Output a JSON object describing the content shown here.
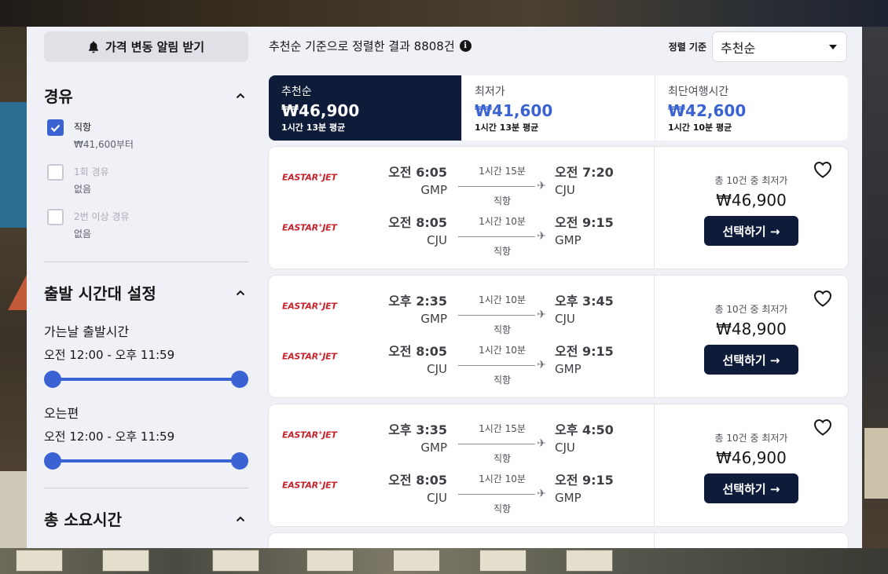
{
  "sidebar": {
    "alert_label": "가격 변동 알림 받기",
    "stops": {
      "title": "경유",
      "options": [
        {
          "label": "직항",
          "sub": "₩41,600부터"
        },
        {
          "label": "1회 경유",
          "sub": "없음"
        },
        {
          "label": "2번 이상 경유",
          "sub": "없음"
        }
      ]
    },
    "departure": {
      "title": "출발 시간대 설정",
      "outbound_label": "가는날 출발시간",
      "outbound_range": "오전 12:00 - 오후 11:59",
      "return_label": "오는편",
      "return_range": "오전 12:00 - 오후 11:59"
    },
    "duration": {
      "title": "총 소요시간"
    }
  },
  "summary": {
    "text": "추천순 기준으로 정렬한 결과 8808건",
    "info_icon": "i"
  },
  "sort": {
    "label": "정렬 기준",
    "value": "추천순"
  },
  "tabs": [
    {
      "name": "추천순",
      "price": "₩46,900",
      "duration": "1시간 13분 평균"
    },
    {
      "name": "최저가",
      "price": "₩41,600",
      "duration": "1시간 13분 평균"
    },
    {
      "name": "최단여행시간",
      "price": "₩42,600",
      "duration": "1시간 10분 평균"
    }
  ],
  "results": [
    {
      "legs": [
        {
          "airline": "EASTAR",
          "airline_b": "JET",
          "dep_time": "오전 6:05",
          "dep_code": "GMP",
          "duration": "1시간 15분",
          "type": "직항",
          "arr_time": "오전 7:20",
          "arr_code": "CJU"
        },
        {
          "airline": "EASTAR",
          "airline_b": "JET",
          "dep_time": "오전 8:05",
          "dep_code": "CJU",
          "duration": "1시간 10분",
          "type": "직항",
          "arr_time": "오전 9:15",
          "arr_code": "GMP"
        }
      ],
      "price_note": "총 10건 중 최저가",
      "price": "₩46,900",
      "button": "선택하기 →"
    },
    {
      "legs": [
        {
          "airline": "EASTAR",
          "airline_b": "JET",
          "dep_time": "오후 2:35",
          "dep_code": "GMP",
          "duration": "1시간 10분",
          "type": "직항",
          "arr_time": "오후 3:45",
          "arr_code": "CJU"
        },
        {
          "airline": "EASTAR",
          "airline_b": "JET",
          "dep_time": "오전 8:05",
          "dep_code": "CJU",
          "duration": "1시간 10분",
          "type": "직항",
          "arr_time": "오전 9:15",
          "arr_code": "GMP"
        }
      ],
      "price_note": "총 10건 중 최저가",
      "price": "₩48,900",
      "button": "선택하기 →"
    },
    {
      "legs": [
        {
          "airline": "EASTAR",
          "airline_b": "JET",
          "dep_time": "오후 3:35",
          "dep_code": "GMP",
          "duration": "1시간 15분",
          "type": "직항",
          "arr_time": "오후 4:50",
          "arr_code": "CJU"
        },
        {
          "airline": "EASTAR",
          "airline_b": "JET",
          "dep_time": "오전 8:05",
          "dep_code": "CJU",
          "duration": "1시간 10분",
          "type": "직항",
          "arr_time": "오전 9:15",
          "arr_code": "GMP"
        }
      ],
      "price_note": "총 10건 중 최저가",
      "price": "₩46,900",
      "button": "선택하기 →"
    }
  ],
  "colors": {
    "accent": "#3a62d2",
    "navy": "#0e1c3a",
    "airline_red": "#c8232c"
  },
  "icons": [
    "bell-icon",
    "info-icon",
    "chevron-up-icon",
    "check-icon",
    "plane-icon",
    "heart-icon",
    "caret-down-icon"
  ]
}
